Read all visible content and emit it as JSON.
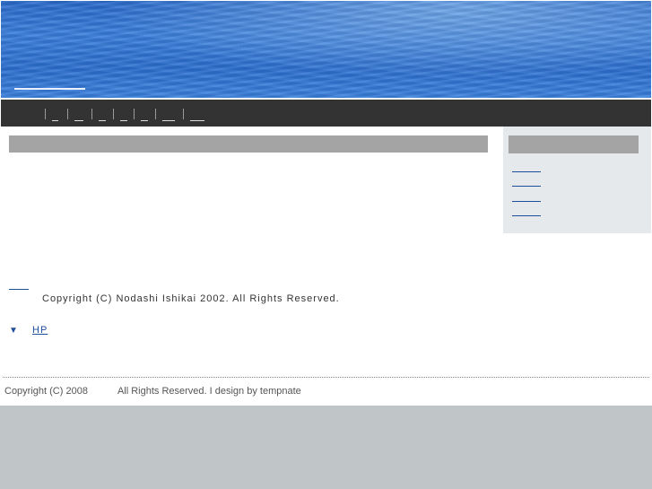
{
  "content": {
    "copyright": "Copyright (C) Nodashi Ishikai 2002. All Rights Reserved.",
    "hp_link": {
      "arrow": "▼",
      "label": "HP"
    }
  },
  "footer": {
    "copyright_left": "Copyright (C) 2008",
    "copyright_right": "All Rights Reserved. I design by tempnate"
  },
  "colors": {
    "nav_background": "#333333",
    "heading_bar": "#a4a4a4",
    "sidebar_background": "#e6e9ec",
    "link": "#1f4e9a",
    "outer_background": "#c0c5c8"
  }
}
